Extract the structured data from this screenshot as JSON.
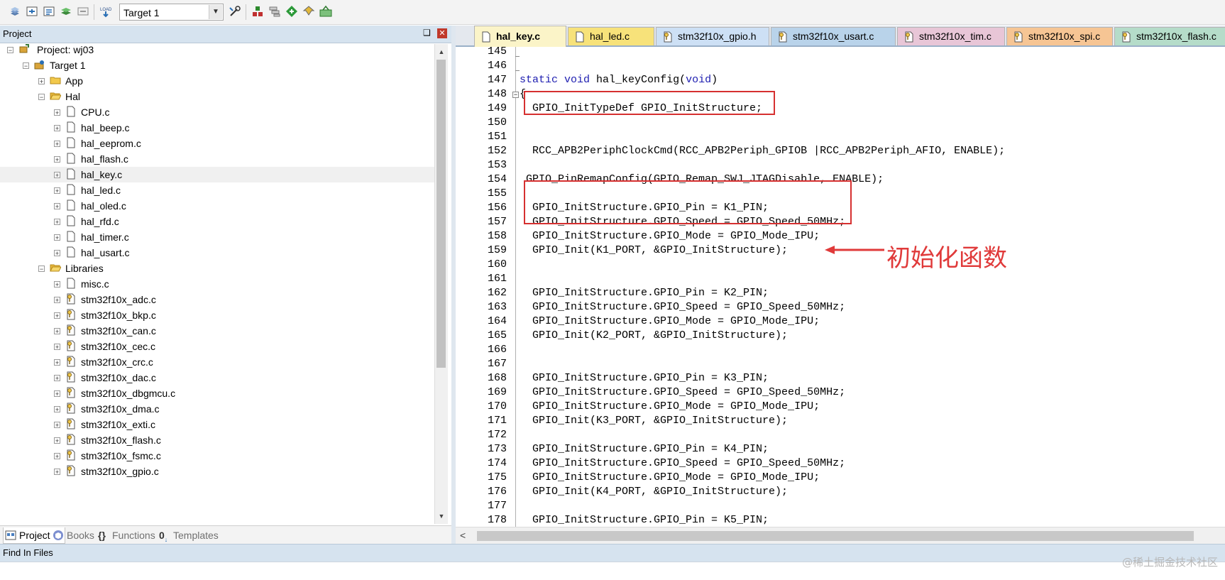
{
  "toolbar": {
    "target_value": "Target 1",
    "icons": [
      "translate-icon",
      "build-icon",
      "rebuild-icon",
      "batch-build-icon",
      "stop-build-icon",
      "download-icon",
      "target-options-icon",
      "manage-components-icon",
      "select-packs-icon",
      "pack-installer-icon",
      "event-recorder-icon",
      "ecosystem-icon"
    ]
  },
  "project_panel": {
    "title": "Project",
    "pin": "❑",
    "close": "✕",
    "tree": [
      {
        "label": "Project: wj03",
        "level": 0,
        "icon": "project",
        "expander": "−"
      },
      {
        "label": "Target 1",
        "level": 1,
        "icon": "target",
        "expander": "−"
      },
      {
        "label": "App",
        "level": 2,
        "icon": "folder",
        "expander": "+"
      },
      {
        "label": "Hal",
        "level": 2,
        "icon": "folder-open",
        "expander": "−"
      },
      {
        "label": "CPU.c",
        "level": 3,
        "icon": "file",
        "expander": "+"
      },
      {
        "label": "hal_beep.c",
        "level": 3,
        "icon": "file",
        "expander": "+"
      },
      {
        "label": "hal_eeprom.c",
        "level": 3,
        "icon": "file",
        "expander": "+"
      },
      {
        "label": "hal_flash.c",
        "level": 3,
        "icon": "file",
        "expander": "+"
      },
      {
        "label": "hal_key.c",
        "level": 3,
        "icon": "file",
        "expander": "+",
        "selected": true
      },
      {
        "label": "hal_led.c",
        "level": 3,
        "icon": "file",
        "expander": "+"
      },
      {
        "label": "hal_oled.c",
        "level": 3,
        "icon": "file",
        "expander": "+"
      },
      {
        "label": "hal_rfd.c",
        "level": 3,
        "icon": "file",
        "expander": "+"
      },
      {
        "label": "hal_timer.c",
        "level": 3,
        "icon": "file",
        "expander": "+"
      },
      {
        "label": "hal_usart.c",
        "level": 3,
        "icon": "file",
        "expander": "+"
      },
      {
        "label": "Libraries",
        "level": 2,
        "icon": "folder-open",
        "expander": "−"
      },
      {
        "label": "misc.c",
        "level": 3,
        "icon": "file",
        "expander": "+"
      },
      {
        "label": "stm32f10x_adc.c",
        "level": 3,
        "icon": "file-key",
        "expander": "+"
      },
      {
        "label": "stm32f10x_bkp.c",
        "level": 3,
        "icon": "file-key",
        "expander": "+"
      },
      {
        "label": "stm32f10x_can.c",
        "level": 3,
        "icon": "file-key",
        "expander": "+"
      },
      {
        "label": "stm32f10x_cec.c",
        "level": 3,
        "icon": "file-key",
        "expander": "+"
      },
      {
        "label": "stm32f10x_crc.c",
        "level": 3,
        "icon": "file-key",
        "expander": "+"
      },
      {
        "label": "stm32f10x_dac.c",
        "level": 3,
        "icon": "file-key",
        "expander": "+"
      },
      {
        "label": "stm32f10x_dbgmcu.c",
        "level": 3,
        "icon": "file-key",
        "expander": "+"
      },
      {
        "label": "stm32f10x_dma.c",
        "level": 3,
        "icon": "file-key",
        "expander": "+"
      },
      {
        "label": "stm32f10x_exti.c",
        "level": 3,
        "icon": "file-key",
        "expander": "+"
      },
      {
        "label": "stm32f10x_flash.c",
        "level": 3,
        "icon": "file-key",
        "expander": "+"
      },
      {
        "label": "stm32f10x_fsmc.c",
        "level": 3,
        "icon": "file-key",
        "expander": "+"
      },
      {
        "label": "stm32f10x_gpio.c",
        "level": 3,
        "icon": "file-key",
        "expander": "+"
      }
    ],
    "tabs": [
      {
        "label": "Project",
        "icon": "project-tab-icon",
        "active": true
      },
      {
        "label": "Books",
        "icon": "books-tab-icon",
        "active": false
      },
      {
        "label": "Functions",
        "icon": "functions-tab-icon",
        "active": false
      },
      {
        "label": "Templates",
        "icon": "templates-tab-icon",
        "active": false
      }
    ]
  },
  "editor": {
    "tabs": [
      {
        "label": "hal_key.c",
        "color": "#fbf4c8",
        "active": true,
        "icon": "file"
      },
      {
        "label": "hal_led.c",
        "color": "#f7e27a",
        "active": false,
        "icon": "file"
      },
      {
        "label": "stm32f10x_gpio.h",
        "color": "#cde0f5",
        "active": false,
        "icon": "file-key"
      },
      {
        "label": "stm32f10x_usart.c",
        "color": "#b9d3ea",
        "active": false,
        "icon": "file-key"
      },
      {
        "label": "stm32f10x_tim.c",
        "color": "#e8c6d7",
        "active": false,
        "icon": "file-key"
      },
      {
        "label": "stm32f10x_spi.c",
        "color": "#f6c594",
        "active": false,
        "icon": "file-key"
      },
      {
        "label": "stm32f10x_flash.c",
        "color": "#b5dcc9",
        "active": false,
        "icon": "file-key"
      },
      {
        "label": "",
        "color": "#d8c8ec",
        "active": false,
        "icon": "file-key"
      }
    ],
    "lines": [
      {
        "n": "145",
        "text": ""
      },
      {
        "n": "146",
        "text": ""
      },
      {
        "n": "147",
        "text": "static void hal_keyConfig(void)"
      },
      {
        "n": "148",
        "text": "{"
      },
      {
        "n": "149",
        "text": "  GPIO_InitTypeDef GPIO_InitStructure;"
      },
      {
        "n": "150",
        "text": ""
      },
      {
        "n": "151",
        "text": ""
      },
      {
        "n": "152",
        "text": "  RCC_APB2PeriphClockCmd(RCC_APB2Periph_GPIOB |RCC_APB2Periph_AFIO, ENABLE);"
      },
      {
        "n": "153",
        "text": ""
      },
      {
        "n": "154",
        "text": " GPIO_PinRemapConfig(GPIO_Remap_SWJ_JTAGDisable, ENABLE);"
      },
      {
        "n": "155",
        "text": ""
      },
      {
        "n": "156",
        "text": "  GPIO_InitStructure.GPIO_Pin = K1_PIN;"
      },
      {
        "n": "157",
        "text": "  GPIO_InitStructure.GPIO_Speed = GPIO_Speed_50MHz;"
      },
      {
        "n": "158",
        "text": "  GPIO_InitStructure.GPIO_Mode = GPIO_Mode_IPU;"
      },
      {
        "n": "159",
        "text": "  GPIO_Init(K1_PORT, &GPIO_InitStructure);"
      },
      {
        "n": "160",
        "text": ""
      },
      {
        "n": "161",
        "text": ""
      },
      {
        "n": "162",
        "text": "  GPIO_InitStructure.GPIO_Pin = K2_PIN;"
      },
      {
        "n": "163",
        "text": "  GPIO_InitStructure.GPIO_Speed = GPIO_Speed_50MHz;"
      },
      {
        "n": "164",
        "text": "  GPIO_InitStructure.GPIO_Mode = GPIO_Mode_IPU;"
      },
      {
        "n": "165",
        "text": "  GPIO_Init(K2_PORT, &GPIO_InitStructure);"
      },
      {
        "n": "166",
        "text": ""
      },
      {
        "n": "167",
        "text": ""
      },
      {
        "n": "168",
        "text": "  GPIO_InitStructure.GPIO_Pin = K3_PIN;"
      },
      {
        "n": "169",
        "text": "  GPIO_InitStructure.GPIO_Speed = GPIO_Speed_50MHz;"
      },
      {
        "n": "170",
        "text": "  GPIO_InitStructure.GPIO_Mode = GPIO_Mode_IPU;"
      },
      {
        "n": "171",
        "text": "  GPIO_Init(K3_PORT, &GPIO_InitStructure);"
      },
      {
        "n": "172",
        "text": ""
      },
      {
        "n": "173",
        "text": "  GPIO_InitStructure.GPIO_Pin = K4_PIN;"
      },
      {
        "n": "174",
        "text": "  GPIO_InitStructure.GPIO_Speed = GPIO_Speed_50MHz;"
      },
      {
        "n": "175",
        "text": "  GPIO_InitStructure.GPIO_Mode = GPIO_Mode_IPU;"
      },
      {
        "n": "176",
        "text": "  GPIO_Init(K4_PORT, &GPIO_InitStructure);"
      },
      {
        "n": "177",
        "text": ""
      },
      {
        "n": "178",
        "text": "  GPIO_InitStructure.GPIO_Pin = K5_PIN;"
      }
    ],
    "keywords": [
      "static",
      "void"
    ],
    "annotation": "初始化函数",
    "annotation_color": "#e03a3a"
  },
  "find_in_files": {
    "title": "Find In Files"
  },
  "watermark": "@稀土掘金技术社区"
}
